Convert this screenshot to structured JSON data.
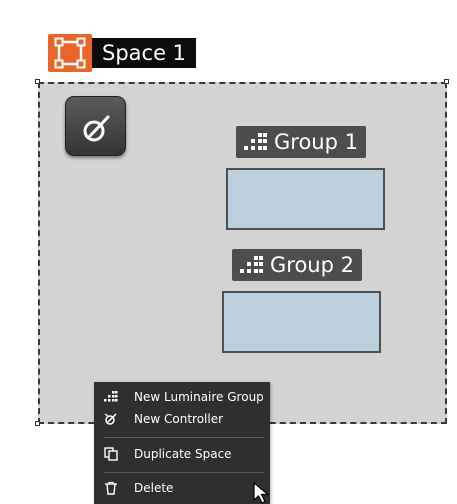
{
  "space": {
    "title": "Space 1",
    "icon": "space-outline-icon",
    "accent_color": "#e8662a"
  },
  "controller": {
    "icon": "controller-dimmer-icon"
  },
  "groups": [
    {
      "label": "Group 1",
      "icon": "luminaire-group-icon"
    },
    {
      "label": "Group 2",
      "icon": "luminaire-group-icon"
    }
  ],
  "context_menu": {
    "items": [
      {
        "label": "New Luminaire Group",
        "icon": "luminaire-group-icon"
      },
      {
        "label": "New Controller",
        "icon": "controller-icon"
      },
      {
        "label": "Duplicate Space",
        "icon": "duplicate-icon"
      },
      {
        "label": "Delete",
        "icon": "trash-icon"
      }
    ]
  },
  "colors": {
    "canvas_bg": "#d3d3d3",
    "group_box": "#bccfdd",
    "menu_bg": "#2f2f2f"
  }
}
